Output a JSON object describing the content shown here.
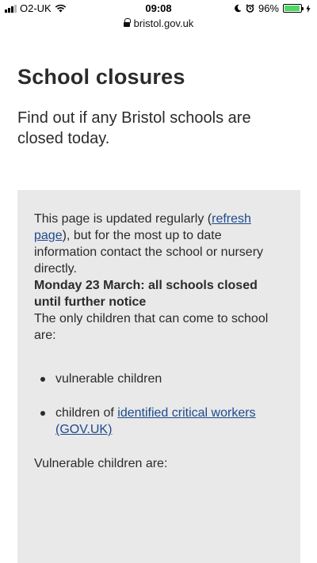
{
  "status_bar": {
    "carrier": "O2-UK",
    "time": "09:08",
    "battery_percent": "96%",
    "battery_level": 0.96
  },
  "url_bar": {
    "domain": "bristol.gov.uk"
  },
  "page": {
    "title": "School closures",
    "lead": "Find out if any Bristol schools are closed today."
  },
  "notice": {
    "intro_before": "This page is updated regularly (",
    "refresh_link": "refresh page",
    "intro_after": "), but for the most up to date information contact the school or nursery directly.",
    "announcement": "Monday 23 March: all schools closed until further notice",
    "only_children": "The only children that can come to school are:",
    "bullet_1": "vulnerable children",
    "bullet_2_prefix": "children of ",
    "bullet_2_link": "identified critical workers (GOV.UK)",
    "vulnerable_heading": "Vulnerable children are:"
  }
}
